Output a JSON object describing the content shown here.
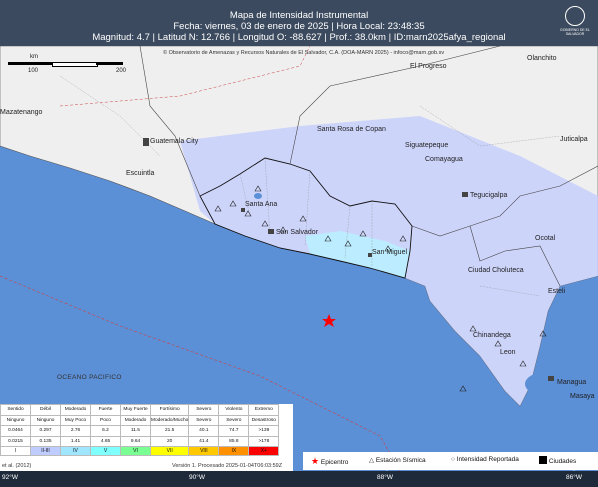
{
  "header": {
    "title": "Mapa de Intensidad Instrumental",
    "date_line": "Fecha: viernes, 03 de enero de 2025 | Hora Local: 23:48:35",
    "details_line": "Magnitud: 4.7 | Latitud N: 12.766 | Longitud O: -88.627 | Prof.: 38.0km | ID:marn2025afya_regional"
  },
  "logo": {
    "text": "GOBIERNO DE EL SALVADOR"
  },
  "copyright": "© Observatorio de Amenazas y Recursos Naturales de El Salvador, C.A. (DOA-MARN 2025) - infoco@marn.gob.sv",
  "scale_bar": {
    "unit": "km",
    "labels": [
      "0",
      "100",
      "200"
    ]
  },
  "places": [
    {
      "name": "Olanchito"
    },
    {
      "name": "El Progreso"
    },
    {
      "name": "Santa Rosa de Copan"
    },
    {
      "name": "Siguatepeque"
    },
    {
      "name": "Juticalpa"
    },
    {
      "name": "Comayagua"
    },
    {
      "name": "Tegucigalpa"
    },
    {
      "name": "Guatemala City"
    },
    {
      "name": "Escuintla"
    },
    {
      "name": "Santa Ana"
    },
    {
      "name": "San Salvador"
    },
    {
      "name": "San Miguel"
    },
    {
      "name": "Ocotal"
    },
    {
      "name": "Ciudad Choluteca"
    },
    {
      "name": "Esteli"
    },
    {
      "name": "Chinandega"
    },
    {
      "name": "Leon"
    },
    {
      "name": "Managua"
    },
    {
      "name": "Masaya"
    },
    {
      "name": "Mazatenango"
    }
  ],
  "ocean_label": "OCEANO PACIFICO",
  "epicenter": {
    "lat": 12.766,
    "lon": -88.627
  },
  "intensity_table": {
    "perceived": [
      "Sentido",
      "Débil",
      "Moderado",
      "Fuerte",
      "Muy Fuerte",
      "Fortísimo",
      "Severo",
      "Violento",
      "Extremo"
    ],
    "damage": [
      "Ninguno",
      "Ninguno",
      "Muy Poco",
      "Poco",
      "Moderado",
      "Moderado/Mucho",
      "Severo",
      "Severo",
      "Desastroso"
    ],
    "pga": [
      "0.0464",
      "0.297",
      "2.76",
      "6.2",
      "11.5",
      "21.5",
      "40.1",
      "74.7",
      ">139"
    ],
    "pgv": [
      "0.0215",
      "0.135",
      "1.41",
      "4.65",
      "9.64",
      "20",
      "41.4",
      "85.8",
      ">178"
    ],
    "scale": [
      "I",
      "II-III",
      "IV",
      "V",
      "VI",
      "VII",
      "VIII",
      "IX",
      "X+"
    ],
    "colors": [
      "#ffffff",
      "#bfccff",
      "#a0e6ff",
      "#80ffff",
      "#7aff93",
      "#ffff00",
      "#ffc800",
      "#ff9100",
      "#ff0000"
    ]
  },
  "footer_info": {
    "left": "et al. (2012)",
    "right": "Versión 1. Procesado 2025-01-04T06:03:59Z"
  },
  "legend": {
    "epicenter": "Epicentro",
    "station": "Estación Sísmica",
    "reported": "Intensidad Reportada",
    "cities": "Ciudades"
  },
  "longitudes": [
    "92°W",
    "90°W",
    "88°W",
    "86°W"
  ],
  "colors": {
    "header_bg": "#3b4a5e",
    "ocean": "#5b8fd6",
    "land": "#f2f2f2",
    "felt": "#c8d2ff",
    "epicenter": "#ff0000"
  }
}
